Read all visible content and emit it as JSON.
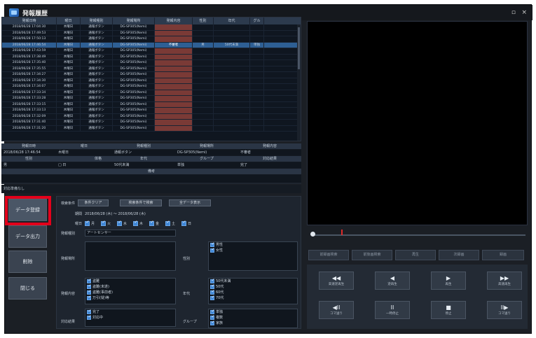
{
  "window": {
    "title": "発報履歴",
    "minimize_label": "▫",
    "close_label": "×"
  },
  "table": {
    "columns": [
      "発報日時",
      "曜日",
      "発報種別",
      "発報場所",
      "発報内容",
      "性別",
      "年代",
      "グル"
    ],
    "rows": [
      [
        "2018/06/28 17:04:30",
        "木曜日",
        "通報ボタン",
        "DG-SP305(Nemi)",
        "",
        "",
        "",
        ""
      ],
      [
        "2018/06/28 17:49:53",
        "木曜日",
        "通報ボタン",
        "DG-SP305(Nemi)",
        "",
        "",
        "",
        ""
      ],
      [
        "2018/06/28 17:50:13",
        "木曜日",
        "通報ボタン",
        "DG-SP305(Nemi)",
        "",
        "",
        "",
        ""
      ],
      [
        "2018/06/28 17:46:54",
        "木曜日",
        "通報ボタン",
        "DG-SP305(Nemi)",
        "不審者",
        "男",
        "50代未満",
        "単独"
      ],
      [
        "2018/06/28 17:43:59",
        "木曜日",
        "通報ボタン",
        "DG-SP305(Nemi)",
        "",
        "",
        "",
        ""
      ],
      [
        "2018/06/28 17:38:49",
        "木曜日",
        "通報ボタン",
        "DG-SP305(Nemi)",
        "",
        "",
        "",
        ""
      ],
      [
        "2018/06/28 17:35:40",
        "木曜日",
        "通報ボタン",
        "DG-SP305(Nemi)",
        "",
        "",
        "",
        ""
      ],
      [
        "2018/06/28 17:35:55",
        "木曜日",
        "通報ボタン",
        "DG-SP305(Nemi)",
        "",
        "",
        "",
        ""
      ],
      [
        "2018/06/28 17:34:27",
        "木曜日",
        "通報ボタン",
        "DG-SP305(Nemi)",
        "",
        "",
        "",
        ""
      ],
      [
        "2018/06/28 17:34:30",
        "木曜日",
        "通報ボタン",
        "DG-SP305(Nemi)",
        "",
        "",
        "",
        ""
      ],
      [
        "2018/06/28 17:34:07",
        "木曜日",
        "通報ボタン",
        "DG-SP305(Nemi)",
        "",
        "",
        "",
        ""
      ],
      [
        "2018/06/28 17:33:34",
        "木曜日",
        "通報ボタン",
        "DG-SP305(Nemi)",
        "",
        "",
        "",
        ""
      ],
      [
        "2018/06/28 17:33:28",
        "木曜日",
        "通報ボタン",
        "DG-SP305(Nemi)",
        "",
        "",
        "",
        ""
      ],
      [
        "2018/06/28 17:33:15",
        "木曜日",
        "通報ボタン",
        "DG-SP305(Nemi)",
        "",
        "",
        "",
        ""
      ],
      [
        "2018/06/28 17:33:13",
        "木曜日",
        "通報ボタン",
        "DG-SP305(Nemi)",
        "",
        "",
        "",
        ""
      ],
      [
        "2018/06/28 17:32:09",
        "木曜日",
        "通報ボタン",
        "DG-SP305(Nemi)",
        "",
        "",
        "",
        ""
      ],
      [
        "2018/06/28 17:31:40",
        "木曜日",
        "通報ボタン",
        "DG-SP305(Nemi)",
        "",
        "",
        "",
        ""
      ],
      [
        "2018/06/28 17:31:20",
        "木曜日",
        "通報ボタン",
        "DG-SP305(Nemi)",
        "",
        "",
        "",
        ""
      ]
    ],
    "selected_index": 3
  },
  "detail": {
    "row1_headers": [
      "発報日時",
      "曜日",
      "発報種別",
      "発報場所",
      "発報内容"
    ],
    "row1_values": [
      "2018/06/28 17:46:54",
      "木曜日",
      "通報ボタン",
      "DG-SP305(Nemi)",
      "不審者"
    ],
    "row2_headers": [
      "性別",
      "",
      "体格",
      "年代",
      "グループ",
      "対応結果"
    ],
    "row2_values": [
      "男",
      "□ 日",
      "",
      "50代未満",
      "単独",
      "完了"
    ],
    "remarks_header": "備考",
    "remarks_value": "",
    "note": "対応準備なし"
  },
  "side_buttons": {
    "data_register": "データ登録",
    "data_output": "データ出力",
    "delete": "削除",
    "close": "閉じる"
  },
  "search": {
    "search_condition_label": "検索条件",
    "clear_label": "条件クリア",
    "search_button": "検索条件で検索",
    "show_all_button": "全データ表示",
    "period_label": "期間",
    "period_value": "2018/06/28 (木) 〜 2018/06/28 (木)",
    "weekday_label": "曜日",
    "weekdays": [
      "月",
      "火",
      "水",
      "木",
      "金",
      "土",
      "日"
    ],
    "type_label": "発報種別",
    "type_value": "アートセンサー",
    "location_label": "発報場所",
    "content_label": "発報内容",
    "content_items": [
      "盗難",
      "盗難(未遂)",
      "盗難(事前者)",
      "万引(疑)等"
    ],
    "result_label": "対応結果",
    "result_items": [
      "完了",
      "対応中"
    ],
    "gender_label": "性別",
    "gender_items": [
      "男性",
      "女性"
    ],
    "age_label": "年代",
    "age_items": [
      "50代未満",
      "50代",
      "60代",
      "70代"
    ],
    "group_label": "グループ",
    "group_items": [
      "単独",
      "複数",
      "家族",
      "団体"
    ]
  },
  "player": {
    "tabs": [
      "前録画検索",
      "前後画検索",
      "再生",
      "次録画",
      "録画"
    ],
    "buttons": [
      {
        "icon": "◀◀",
        "label": "高速逆再生"
      },
      {
        "icon": "◀",
        "label": "逆再生"
      },
      {
        "icon": "▶",
        "label": "再生"
      },
      {
        "icon": "▶▶",
        "label": "高速再生"
      },
      {
        "icon": "◀II",
        "label": "コマ送り"
      },
      {
        "icon": "II",
        "label": "一時停止"
      },
      {
        "icon": "■",
        "label": "停止"
      },
      {
        "icon": "II▶",
        "label": "コマ送り"
      }
    ]
  },
  "colors": {
    "highlight": "#e4001b",
    "selected_row": "#2e5f94",
    "empty_cell": "#7a3a36",
    "checkbox": "#3e86d6"
  }
}
